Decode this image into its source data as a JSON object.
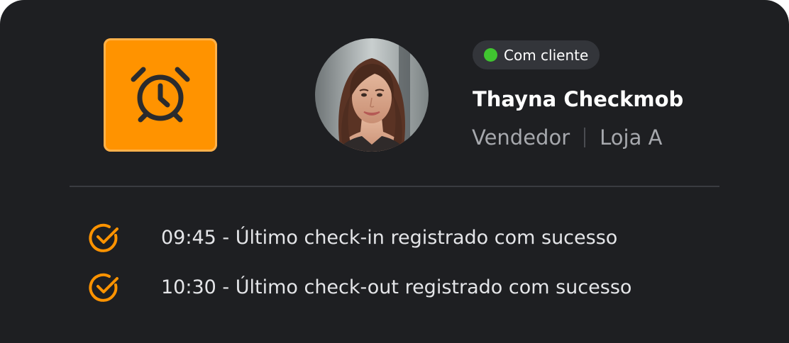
{
  "alarm_tile": {
    "icon": "alarm-clock-icon",
    "color": "#ff9300"
  },
  "user": {
    "avatar": "avatar-photo",
    "status": {
      "label": "Com cliente",
      "color": "#40c530"
    },
    "name": "Thayna Checkmob",
    "role": "Vendedor",
    "store": "Loja A"
  },
  "log": {
    "icon": "check-circle-icon",
    "icon_color": "#ff9300",
    "entries": [
      {
        "text": "09:45 - Último check-in registrado com sucesso"
      },
      {
        "text": "10:30 - Último check-out registrado com sucesso"
      }
    ]
  },
  "colors": {
    "background": "#1e1f22",
    "accent": "#ff9300",
    "badge_background": "#33353a"
  }
}
